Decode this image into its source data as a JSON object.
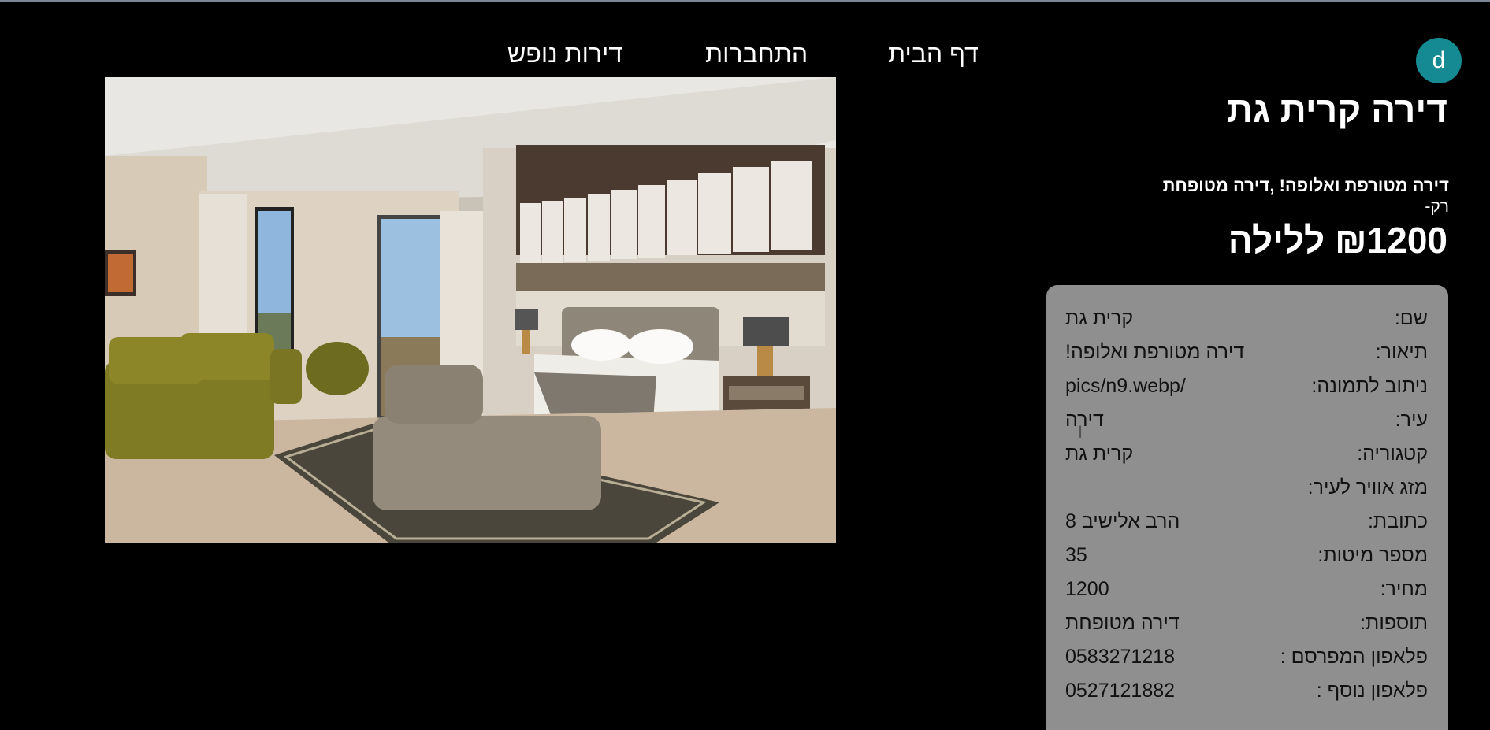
{
  "nav": {
    "home": "דף הבית",
    "connect": "התחברות",
    "apartments": "דירות נופש"
  },
  "user": {
    "avatar_letter": "d",
    "avatar_color": "#168a93"
  },
  "listing": {
    "title": "דירה קרית גת",
    "subtitle": "דירה מטורפת ואלופה! ,דירה מטופחת",
    "only_label": "רק-",
    "price_display": "₪1200 ללילה"
  },
  "details": [
    {
      "label": "שם:",
      "value": "קרית גת"
    },
    {
      "label": "תיאור:",
      "value": "דירה מטורפת ואלופה!"
    },
    {
      "label": "ניתוב לתמונה:",
      "value": "pics/n9.webp/"
    },
    {
      "label": "עיר:",
      "value": "דירה"
    },
    {
      "label": "קטגוריה:",
      "value": "קרית גת"
    },
    {
      "label": "מזג אוויר לעיר:",
      "value": ""
    },
    {
      "label": "כתובת:",
      "value": "הרב אלישיב 8"
    },
    {
      "label": "מספר מיטות:",
      "value": "35"
    },
    {
      "label": "מחיר:",
      "value": "1200"
    },
    {
      "label": "תוספות:",
      "value": "דירה מטופחת"
    },
    {
      "label": "פלאפון המפרסם :",
      "value": "0583271218"
    },
    {
      "label": "פלאפון נוסף :",
      "value": "0527121882"
    }
  ],
  "colors": {
    "background": "#000000",
    "card": "#8f8f8f",
    "accent": "#168a93"
  }
}
